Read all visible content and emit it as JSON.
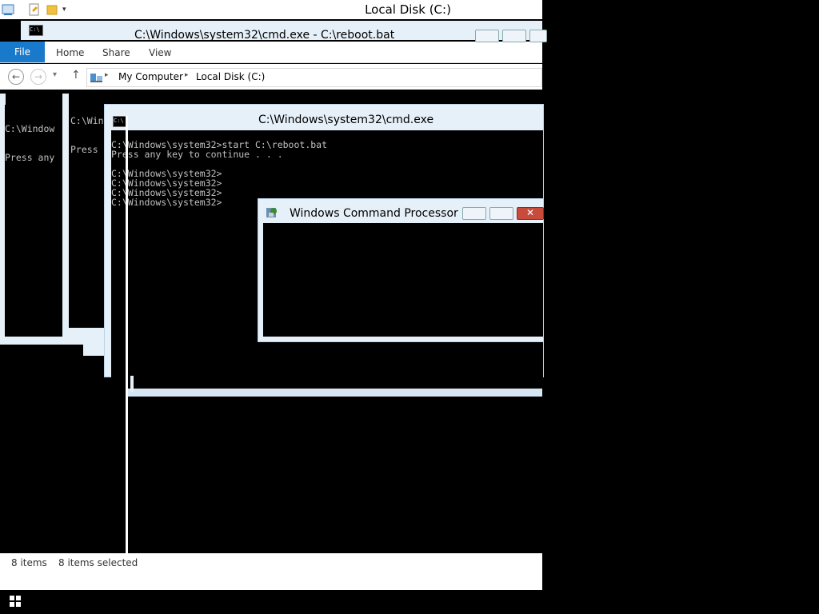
{
  "explorer": {
    "title": "Local Disk (C:)",
    "ribbon_tabs": {
      "file": "File",
      "home": "Home",
      "share": "Share",
      "view": "View"
    },
    "breadcrumb": {
      "root": "My Computer",
      "current": "Local Disk (C:)"
    },
    "status": {
      "items": "8 items",
      "selected": "8 items selected"
    }
  },
  "cmd_back": {
    "title": "C:\\Windows\\system32\\cmd.exe - C:\\reboot.bat",
    "console_lines": [
      "C:\\Windows\\system32>start C:\\reboot.bat",
      "Press"
    ]
  },
  "cmd_leftmost": {
    "console_lines": [
      "C:\\Window",
      "Press any"
    ]
  },
  "cmd_front": {
    "title": "C:\\Windows\\system32\\cmd.exe",
    "console_text": "C:\\Windows\\system32>start C:\\reboot.bat\nPress any key to continue . . .\n\nC:\\Windows\\system32>\nC:\\Windows\\system32>\nC:\\Windows\\system32>\nC:\\Windows\\system32>"
  },
  "dialog": {
    "title": "Windows Command Processor"
  },
  "colors": {
    "file_tab": "#1979ca",
    "close_button": "#c84b3c",
    "window_frame": "#e6f0f8"
  }
}
